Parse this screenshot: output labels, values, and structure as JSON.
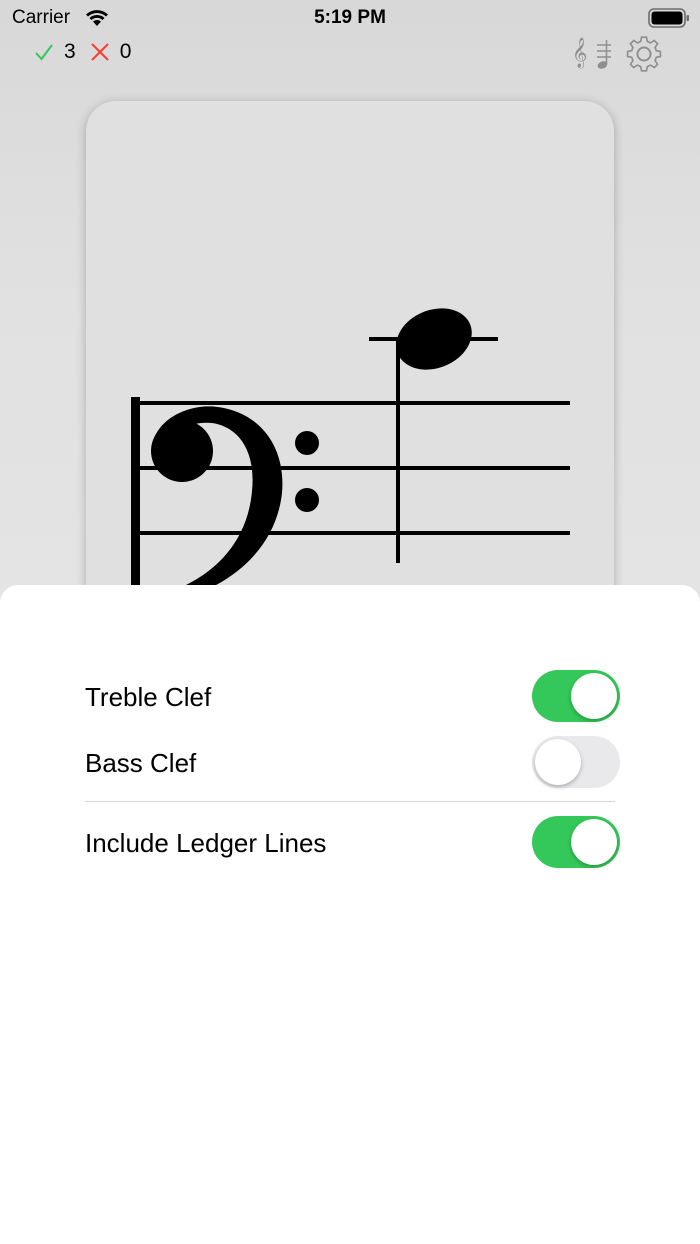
{
  "status_bar": {
    "carrier": "Carrier",
    "time": "5:19 PM"
  },
  "score": {
    "correct_count": "3",
    "wrong_count": "0",
    "correct_color": "#34c759",
    "wrong_color": "#ff3b30"
  },
  "toolbar": {
    "icons": [
      "treble-clef-icon",
      "ledger-lines-icon",
      "gear-icon"
    ],
    "treble_glyph": "𝄞"
  },
  "card": {
    "clef": "bass",
    "note": "ledger line above staff"
  },
  "settings": {
    "treble_clef": {
      "label": "Treble Clef",
      "on": true
    },
    "bass_clef": {
      "label": "Bass Clef",
      "on": false
    },
    "ledger_lines": {
      "label": "Include Ledger Lines",
      "on": true
    }
  }
}
